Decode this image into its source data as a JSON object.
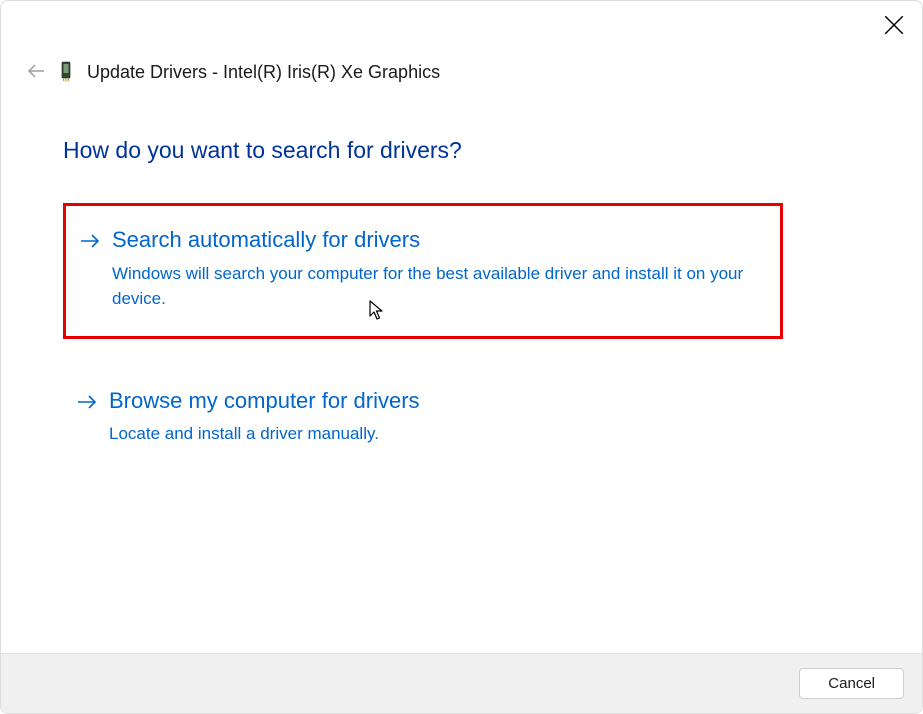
{
  "window": {
    "title": "Update Drivers - Intel(R) Iris(R) Xe Graphics"
  },
  "heading": "How do you want to search for drivers?",
  "options": [
    {
      "title": "Search automatically for drivers",
      "description": "Windows will search your computer for the best available driver and install it on your device.",
      "highlighted": true
    },
    {
      "title": "Browse my computer for drivers",
      "description": "Locate and install a driver manually.",
      "highlighted": false
    }
  ],
  "footer": {
    "cancel_label": "Cancel"
  }
}
